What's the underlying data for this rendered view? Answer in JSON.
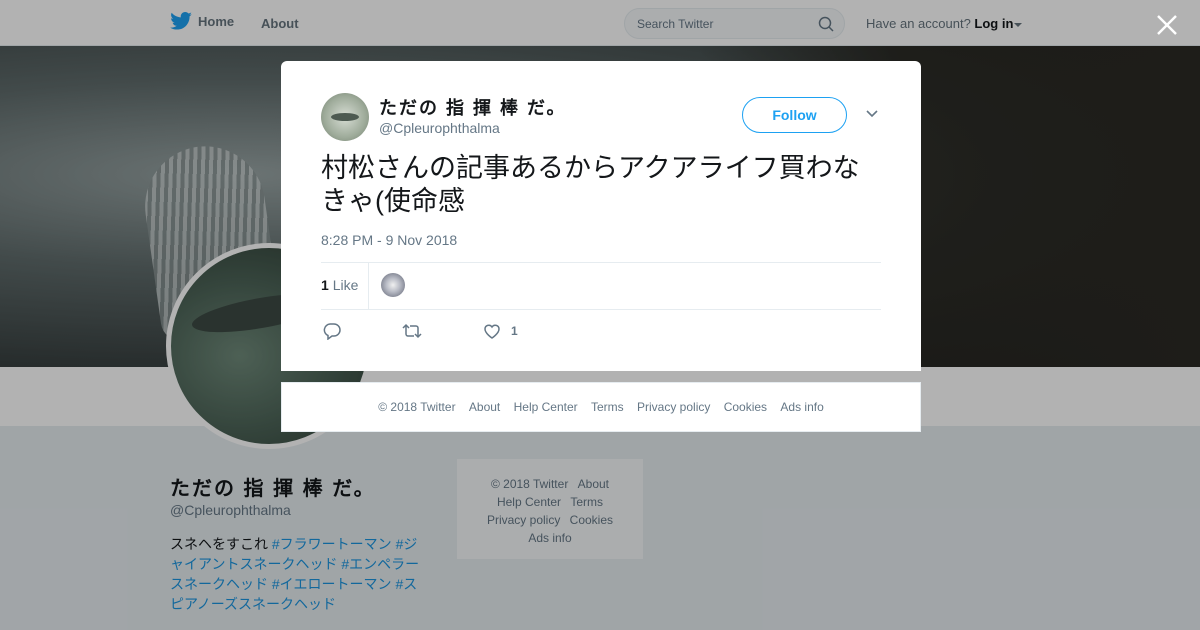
{
  "nav": {
    "home_label": "Home",
    "about_label": "About",
    "search_placeholder": "Search Twitter",
    "account_prompt": "Have an account?",
    "login_label": "Log in"
  },
  "profile": {
    "name": "ただの 指 揮 棒 だ。",
    "handle": "@Cpleurophthalma",
    "bio_text": "スネヘをすこれ ",
    "bio_tags": [
      "#フラワートーマン",
      "#ジャイアントスネークヘッド",
      "#エンペラースネークヘッド",
      "#イエロートーマン",
      "#スピアノーズスネークヘッド"
    ]
  },
  "side_footer": {
    "copyright": "© 2018 Twitter",
    "about": "About",
    "help": "Help Center",
    "terms": "Terms",
    "privacy": "Privacy policy",
    "cookies": "Cookies",
    "ads": "Ads info"
  },
  "tweet": {
    "author_name": "ただの 指 揮 棒 だ。",
    "author_handle": "@Cpleurophthalma",
    "follow_label": "Follow",
    "text": "村松さんの記事あるからアクアライフ買わなきゃ(使命感",
    "timestamp": "8:28 PM - 9 Nov 2018",
    "like_count": "1",
    "like_label": "Like",
    "action_like_count": "1"
  },
  "modal_footer": {
    "copyright": "© 2018 Twitter",
    "about": "About",
    "help": "Help Center",
    "terms": "Terms",
    "privacy": "Privacy policy",
    "cookies": "Cookies",
    "ads": "Ads info"
  },
  "colors": {
    "twitter_blue": "#1da1f2",
    "link_blue": "#1b95e0",
    "muted_text": "#657786"
  },
  "icons": [
    "twitter-bird-icon",
    "search-icon",
    "caret-down-icon",
    "close-icon",
    "chevron-down-icon",
    "reply-icon",
    "retweet-icon",
    "heart-icon"
  ]
}
